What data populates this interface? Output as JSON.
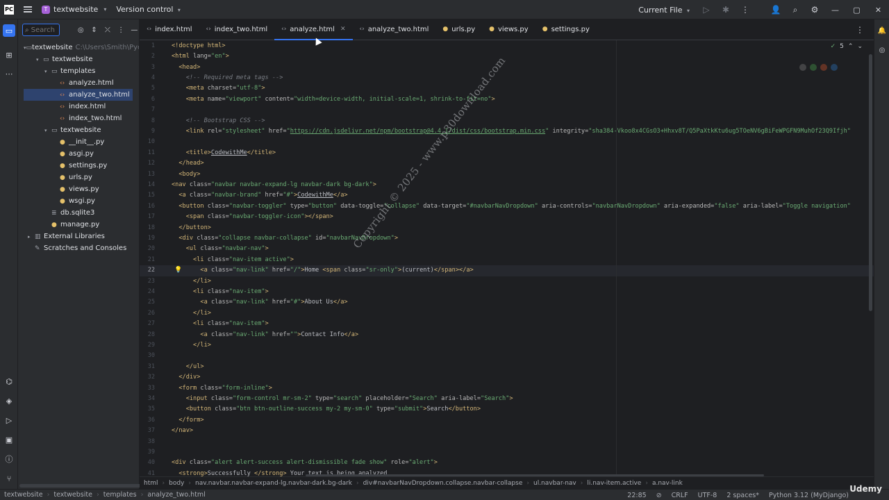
{
  "titlebar": {
    "project_badge": "T",
    "project_name": "textwebsite",
    "version_control": "Version control",
    "run_config": "Current File"
  },
  "project_panel": {
    "search_placeholder": "Search",
    "tree": [
      {
        "label": "textwebsite",
        "path": "C:\\Users\\Smith\\Pych",
        "type": "folder",
        "depth": 0,
        "expanded": true
      },
      {
        "label": "textwebsite",
        "type": "folder",
        "depth": 1,
        "expanded": true
      },
      {
        "label": "templates",
        "type": "folder",
        "depth": 2,
        "expanded": true
      },
      {
        "label": "analyze.html",
        "type": "html",
        "depth": 3
      },
      {
        "label": "analyze_two.html",
        "type": "html",
        "depth": 3,
        "selected": true
      },
      {
        "label": "index.html",
        "type": "html",
        "depth": 3
      },
      {
        "label": "index_two.html",
        "type": "html",
        "depth": 3
      },
      {
        "label": "textwebsite",
        "type": "folder",
        "depth": 2,
        "expanded": true
      },
      {
        "label": "__init__.py",
        "type": "py",
        "depth": 3
      },
      {
        "label": "asgi.py",
        "type": "py",
        "depth": 3
      },
      {
        "label": "settings.py",
        "type": "py",
        "depth": 3
      },
      {
        "label": "urls.py",
        "type": "py",
        "depth": 3
      },
      {
        "label": "views.py",
        "type": "py",
        "depth": 3
      },
      {
        "label": "wsgi.py",
        "type": "py",
        "depth": 3
      },
      {
        "label": "db.sqlite3",
        "type": "file",
        "depth": 2
      },
      {
        "label": "manage.py",
        "type": "py",
        "depth": 2
      },
      {
        "label": "External Libraries",
        "type": "lib",
        "depth": 0,
        "expanded": false
      },
      {
        "label": "Scratches and Consoles",
        "type": "scratch",
        "depth": 0
      }
    ]
  },
  "tabs": [
    {
      "label": "index.html",
      "type": "html"
    },
    {
      "label": "index_two.html",
      "type": "html"
    },
    {
      "label": "analyze.html",
      "type": "html",
      "active": true
    },
    {
      "label": "analyze_two.html",
      "type": "html"
    },
    {
      "label": "urls.py",
      "type": "py"
    },
    {
      "label": "views.py",
      "type": "py"
    },
    {
      "label": "settings.py",
      "type": "py"
    }
  ],
  "editor": {
    "inspection_count": "5",
    "current_line": 22,
    "lines": [
      {
        "n": "1",
        "html": "<span class='t'>&lt;!doctype html&gt;</span>"
      },
      {
        "n": "2",
        "html": "<span class='t'>&lt;html </span><span class='a'>lang=</span><span class='s'>\"en\"</span><span class='t'>&gt;</span>"
      },
      {
        "n": "3",
        "html": "  <span class='t'>&lt;head&gt;</span>"
      },
      {
        "n": "4",
        "html": "    <span class='c'>&lt;!-- Required meta tags --&gt;</span>"
      },
      {
        "n": "5",
        "html": "    <span class='t'>&lt;meta </span><span class='a'>charset=</span><span class='s'>\"utf-8\"</span><span class='t'>&gt;</span>"
      },
      {
        "n": "6",
        "html": "    <span class='t'>&lt;meta </span><span class='a'>name=</span><span class='s'>\"viewport\"</span><span class='a'> content=</span><span class='s'>\"width=device-width, initial-scale=1, shrink-to-fit=no\"</span><span class='t'>&gt;</span>"
      },
      {
        "n": "7",
        "html": ""
      },
      {
        "n": "8",
        "html": "    <span class='c'>&lt;!-- Bootstrap CSS --&gt;</span>"
      },
      {
        "n": "9",
        "html": "    <span class='t'>&lt;link </span><span class='a'>rel=</span><span class='s'>\"stylesheet\"</span><span class='a'> href=</span><span class='s'>\"</span><span class='u'>https://cdn.jsdelivr.net/npm/bootstrap@4.4.1/dist/css/bootstrap.min.css</span><span class='s'>\"</span><span class='a'> integrity=</span><span class='s'>\"sha384-Vkoo8x4CGsO3+Hhxv8T/Q5PaXtkKtu6ug5TOeNV6gBiFeWPGFN9MuhOf23Q9Ifjh\"</span>"
      },
      {
        "n": "10",
        "html": ""
      },
      {
        "n": "11",
        "html": "    <span class='t'>&lt;title&gt;</span><span class='p' style='text-decoration:underline'>CodewithMe</span><span class='t'>&lt;/title&gt;</span>"
      },
      {
        "n": "12",
        "html": "  <span class='t'>&lt;/head&gt;</span>"
      },
      {
        "n": "13",
        "html": "  <span class='t'>&lt;body&gt;</span>"
      },
      {
        "n": "14",
        "html": "<span class='t'>&lt;nav </span><span class='a'>class=</span><span class='s'>\"navbar navbar-expand-lg navbar-dark bg-dark\"</span><span class='t'>&gt;</span>"
      },
      {
        "n": "15",
        "html": "  <span class='t'>&lt;a </span><span class='a'>class=</span><span class='s'>\"navbar-brand\"</span><span class='a'> href=</span><span class='s'>\"#\"</span><span class='t'>&gt;</span><span class='p' style='text-decoration:underline'>CodewithMe</span><span class='t'>&lt;/a&gt;</span>"
      },
      {
        "n": "16",
        "html": "  <span class='t'>&lt;button </span><span class='a'>class=</span><span class='s'>\"navbar-toggler\"</span><span class='a'> type=</span><span class='s'>\"button\"</span><span class='a'> data-toggle=</span><span class='s'>\"collapse\"</span><span class='a'> data-target=</span><span class='s'>\"#navbarNavDropdown\"</span><span class='a'> aria-controls=</span><span class='s'>\"navbarNavDropdown\"</span><span class='a'> aria-expanded=</span><span class='s'>\"false\"</span><span class='a'> aria-label=</span><span class='s'>\"Toggle navigation\"</span>"
      },
      {
        "n": "17",
        "html": "    <span class='t'>&lt;span </span><span class='a'>class=</span><span class='s'>\"navbar-toggler-icon\"</span><span class='t'>&gt;&lt;/span&gt;</span>"
      },
      {
        "n": "18",
        "html": "  <span class='t'>&lt;/button&gt;</span>"
      },
      {
        "n": "19",
        "html": "  <span class='t'>&lt;div </span><span class='a'>class=</span><span class='s'>\"collapse navbar-collapse\"</span><span class='a'> id=</span><span class='s'>\"navbarNavDropdown\"</span><span class='t'>&gt;</span>"
      },
      {
        "n": "20",
        "html": "    <span class='t'>&lt;ul </span><span class='a'>class=</span><span class='s'>\"navbar-nav\"</span><span class='t'>&gt;</span>"
      },
      {
        "n": "21",
        "html": "      <span class='t'>&lt;li </span><span class='a'>class=</span><span class='s'>\"nav-item active\"</span><span class='t'>&gt;</span>"
      },
      {
        "n": "22",
        "html": "        <span class='t'>&lt;a </span><span class='a'>class=</span><span class='s'>\"nav-link\"</span><span class='a'> href=</span><span class='s'>\"/\"</span><span class='t'>&gt;</span><span class='p'>Home </span><span class='t'>&lt;span </span><span class='a'>class=</span><span class='s'>\"sr-only\"</span><span class='t'>&gt;</span><span class='p'>(current)</span><span class='t'>&lt;/span&gt;&lt;/a&gt;</span>"
      },
      {
        "n": "23",
        "html": "      <span class='t'>&lt;/li&gt;</span>"
      },
      {
        "n": "24",
        "html": "      <span class='t'>&lt;li </span><span class='a'>class=</span><span class='s'>\"nav-item\"</span><span class='t'>&gt;</span>"
      },
      {
        "n": "25",
        "html": "        <span class='t'>&lt;a </span><span class='a'>class=</span><span class='s'>\"nav-link\"</span><span class='a'> href=</span><span class='s'>\"#\"</span><span class='t'>&gt;</span><span class='p'>About Us</span><span class='t'>&lt;/a&gt;</span>"
      },
      {
        "n": "26",
        "html": "      <span class='t'>&lt;/li&gt;</span>"
      },
      {
        "n": "27",
        "html": "      <span class='t'>&lt;li </span><span class='a'>class=</span><span class='s'>\"nav-item\"</span><span class='t'>&gt;</span>"
      },
      {
        "n": "28",
        "html": "        <span class='t'>&lt;a </span><span class='a'>class=</span><span class='s'>\"nav-link\"</span><span class='a'> href=</span><span class='s'>\"\"</span><span class='t'>&gt;</span><span class='p'>Contact Info</span><span class='t'>&lt;/a&gt;</span>"
      },
      {
        "n": "29",
        "html": "      <span class='t'>&lt;/li&gt;</span>"
      },
      {
        "n": "30",
        "html": ""
      },
      {
        "n": "31",
        "html": "    <span class='t'>&lt;/ul&gt;</span>"
      },
      {
        "n": "32",
        "html": "  <span class='t'>&lt;/div&gt;</span>"
      },
      {
        "n": "33",
        "html": "  <span class='t'>&lt;form </span><span class='a'>class=</span><span class='s'>\"form-inline\"</span><span class='t'>&gt;</span>"
      },
      {
        "n": "34",
        "html": "    <span class='t'>&lt;input </span><span class='a'>class=</span><span class='s'>\"form-control mr-sm-2\"</span><span class='a'> type=</span><span class='s'>\"search\"</span><span class='a'> placeholder=</span><span class='s'>\"Search\"</span><span class='a'> aria-label=</span><span class='s'>\"Search\"</span><span class='t'>&gt;</span>"
      },
      {
        "n": "35",
        "html": "    <span class='t'>&lt;button </span><span class='a'>class=</span><span class='s'>\"btn btn-outline-success my-2 my-sm-0\"</span><span class='a'> type=</span><span class='s'>\"submit\"</span><span class='t'>&gt;</span><span class='p'>Search</span><span class='t'>&lt;/button&gt;</span>"
      },
      {
        "n": "36",
        "html": "  <span class='t'>&lt;/form&gt;</span>"
      },
      {
        "n": "37",
        "html": "<span class='t'>&lt;/nav&gt;</span>"
      },
      {
        "n": "38",
        "html": ""
      },
      {
        "n": "39",
        "html": ""
      },
      {
        "n": "40",
        "html": "<span class='t'>&lt;div </span><span class='a'>class=</span><span class='s'>\"alert alert-success alert-dismissible fade show\"</span><span class='a'> role=</span><span class='s'>\"alert\"</span><span class='t'>&gt;</span>"
      },
      {
        "n": "41",
        "html": "  <span class='t'>&lt;strong&gt;</span><span class='p'>Successfully </span><span class='t'>&lt;/strong&gt;</span><span class='p'> Your text is being analyzed</span>"
      }
    ]
  },
  "watermark": "Copyright © 2025 - www.p30download.com",
  "breadcrumbs": [
    "html",
    "body",
    "nav.navbar.navbar-expand-lg.navbar-dark.bg-dark",
    "div#navbarNavDropdown.collapse.navbar-collapse",
    "ul.navbar-nav",
    "li.nav-item.active",
    "a.nav-link"
  ],
  "statusbar": {
    "path": [
      "textwebsite",
      "textwebsite",
      "templates",
      "analyze_two.html"
    ],
    "position": "22:85",
    "line_sep": "CRLF",
    "encoding": "UTF-8",
    "indent": "2 spaces*",
    "interpreter": "Python 3.12 (MyDjango)"
  },
  "brand": "Udemy",
  "colors": {
    "accent": "#3574f0",
    "selection": "#2e436e"
  }
}
